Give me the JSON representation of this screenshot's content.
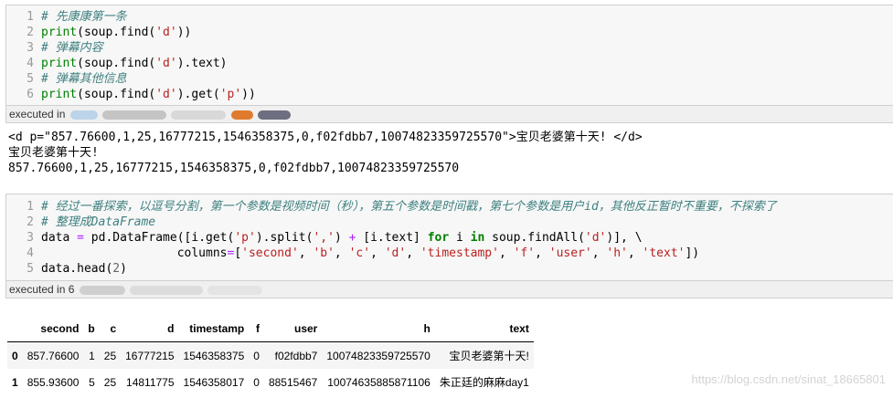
{
  "cell1": {
    "line_numbers": [
      "1",
      "2",
      "3",
      "4",
      "5",
      "6"
    ],
    "comments": [
      "# 先康康第一条",
      "# 弹幕内容",
      "# 弹幕其他信息"
    ],
    "print_kw": "print",
    "soup_find": "(soup.find(",
    "arg_d": "'d'",
    "close2": "))",
    "text_attr": ").text)",
    "get_part": ").get(",
    "arg_p": "'p'",
    "close_paren": ")",
    "executed": "executed in"
  },
  "output1": {
    "lines": [
      "<d p=\"857.76600,1,25,16777215,1546358375,0,f02fdbb7,10074823359725570\">宝贝老婆第十天! </d>",
      "宝贝老婆第十天!",
      "857.76600,1,25,16777215,1546358375,0,f02fdbb7,10074823359725570"
    ]
  },
  "cell2": {
    "line_numbers": [
      "1",
      "2",
      "3",
      "4",
      "5"
    ],
    "comments": [
      "# 经过一番探索，以逗号分割，第一个参数是视频时间（秒），第五个参数是时间戳，第七个参数是用户id，其他反正暂时不重要，不探索了",
      "# 整理成DataFrame"
    ],
    "l3_a": "data ",
    "eq": "=",
    "l3_b": " pd.DataFrame([i.get(",
    "arg_p": "'p'",
    "l3_c": ").split(",
    "comma_str": "','",
    "l3_d": ") ",
    "plus": "+",
    "l3_e": " [i.text] ",
    "for_kw": "for",
    "l3_f": " i ",
    "in_kw": "in",
    "l3_g": " soup.findAll(",
    "arg_d": "'d'",
    "l3_h": ")], \\",
    "l4_indent": "                   columns",
    "l4_open": "[",
    "cols": [
      "'second'",
      "'b'",
      "'c'",
      "'d'",
      "'timestamp'",
      "'f'",
      "'user'",
      "'h'",
      "'text'"
    ],
    "sep": ", ",
    "l4_close": "])",
    "l5_a": "data.head(",
    "l5_num": "2",
    "l5_b": ")",
    "executed": "executed in 6"
  },
  "dataframe": {
    "columns": [
      "",
      "second",
      "b",
      "c",
      "d",
      "timestamp",
      "f",
      "user",
      "h",
      "text"
    ],
    "rows": [
      [
        "0",
        "857.76600",
        "1",
        "25",
        "16777215",
        "1546358375",
        "0",
        "f02fdbb7",
        "10074823359725570",
        "宝贝老婆第十天!"
      ],
      [
        "1",
        "855.93600",
        "5",
        "25",
        "14811775",
        "1546358017",
        "0",
        "88515467",
        "10074635885871106",
        "朱正廷的麻麻day1"
      ]
    ]
  },
  "watermark": "https://blog.csdn.net/sinat_18665801",
  "colors": {
    "comment": "#408080",
    "keyword": "#008000",
    "string": "#ba2121",
    "number": "#666666",
    "operator": "#aa22ff",
    "cell_bg": "#f7f7f7"
  }
}
